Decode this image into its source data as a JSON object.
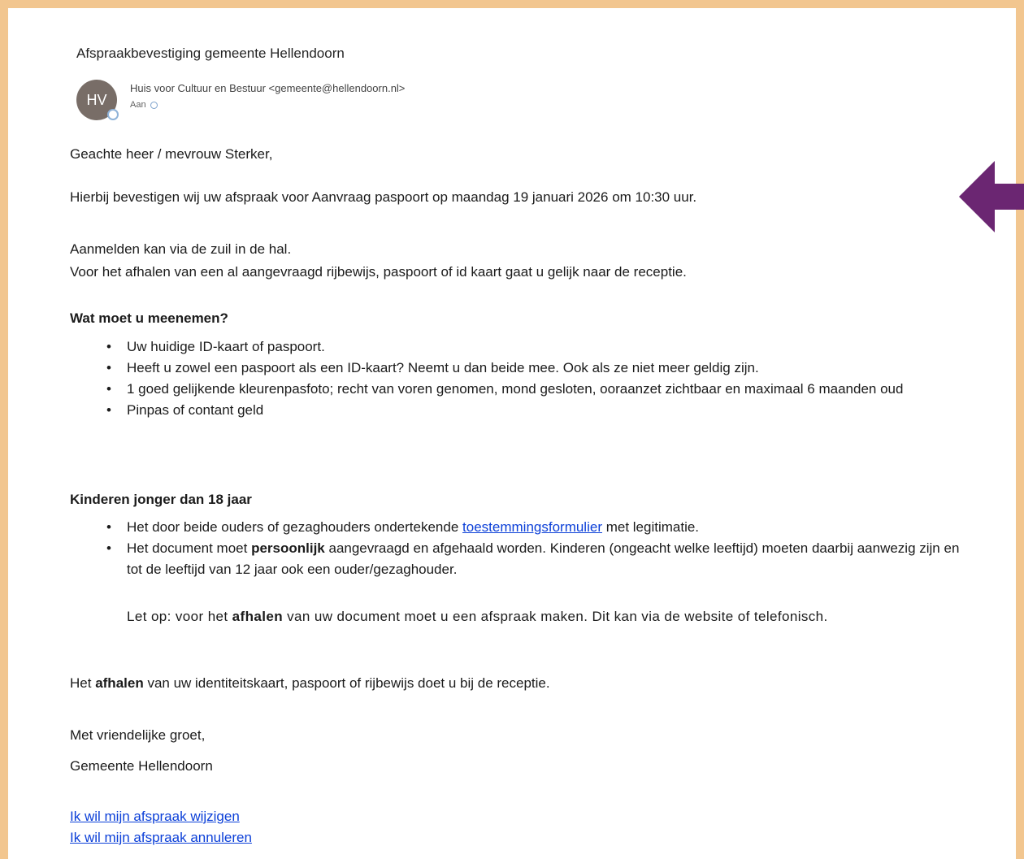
{
  "email": {
    "subject": "Afspraakbevestiging gemeente Hellendoorn",
    "avatar_initials": "HV",
    "sender": "Huis voor Cultuur en Bestuur <gemeente@hellendoorn.nl>",
    "to_label": "Aan"
  },
  "body": {
    "greeting": "Geachte heer / mevrouw Sterker,",
    "confirmation": "Hierbij bevestigen wij uw afspraak voor Aanvraag paspoort op maandag 19 januari 2026 om 10:30 uur.",
    "checkin_line1": "Aanmelden kan via de zuil in de hal.",
    "checkin_line2": "Voor het afhalen van een al aangevraagd rijbewijs, paspoort of id kaart gaat u gelijk naar de receptie.",
    "bring_heading": "Wat moet u meenemen?",
    "bring_items": [
      "Uw huidige ID-kaart of paspoort.",
      "Heeft u zowel een paspoort als een ID-kaart? Neemt u dan beide mee. Ook als ze niet meer geldig zijn.",
      "1 goed gelijkende kleurenpasfoto; recht van voren genomen, mond gesloten, ooraanzet zichtbaar en maximaal 6 maanden oud",
      "Pinpas of contant geld"
    ],
    "children_heading": "Kinderen jonger dan 18 jaar",
    "children_item1_pre": "Het door beide ouders of gezaghouders ondertekende ",
    "children_item1_link": "toestemmingsformulier",
    "children_item1_post": " met legitimatie.",
    "children_item2_pre": "Het document moet ",
    "children_item2_bold": "persoonlijk",
    "children_item2_post": " aangevraagd en afgehaald worden. Kinderen (ongeacht welke leeftijd) moeten daarbij aanwezig zijn en tot de leeftijd van 12 jaar ook een ouder/gezaghouder.",
    "note_pre": "Let op: voor het ",
    "note_bold": "afhalen",
    "note_post": " van uw document moet u een afspraak maken. Dit kan via de website of telefonisch.",
    "pickup_pre": "Het ",
    "pickup_bold": "afhalen",
    "pickup_post": " van uw identiteitskaart, paspoort of rijbewijs doet u bij de receptie.",
    "closing": "Met vriendelijke groet,",
    "signature": "Gemeente Hellendoorn",
    "link_change": "Ik wil mijn afspraak wijzigen",
    "link_cancel": "Ik wil mijn afspraak annuleren"
  },
  "colors": {
    "frame": "#f2c68f",
    "arrow": "#6b2672",
    "link": "#0b3fd8",
    "avatar": "#786d67"
  },
  "icons": {
    "arrow": "arrow-left-icon",
    "presence": "presence-status-icon"
  }
}
